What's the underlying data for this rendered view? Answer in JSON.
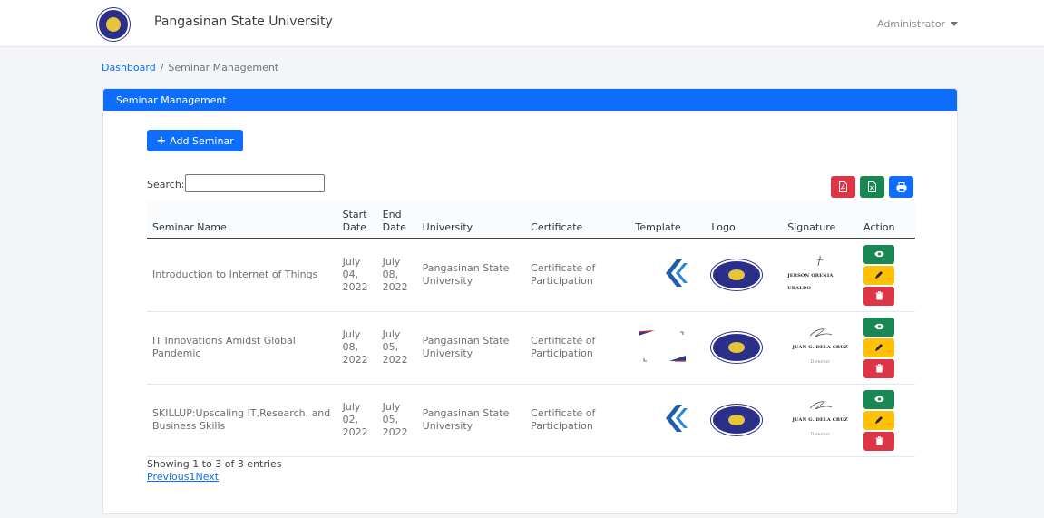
{
  "header": {
    "brand_name": "Pangasinan State University",
    "user_label": "Administrator"
  },
  "breadcrumb": {
    "home": "Dashboard",
    "separator": "/",
    "current": "Seminar Management"
  },
  "card": {
    "title": "Seminar Management",
    "add_button_label": "Add Seminar",
    "search_label": "Search:",
    "search_value": ""
  },
  "exports": [
    {
      "icon": "pdf-icon"
    },
    {
      "icon": "excel-icon"
    },
    {
      "icon": "print-icon"
    }
  ],
  "table": {
    "columns": [
      "Seminar Name",
      "Start Date",
      "End Date",
      "University",
      "Certificate",
      "Template",
      "Logo",
      "Signature",
      "Action"
    ],
    "rows": [
      {
        "name": "Introduction to Internet of Things",
        "start": "July 04, 2022",
        "end": "July 08, 2022",
        "university": "Pangasinan State University",
        "certificate": "Certificate of Participation",
        "template": "chevron",
        "signature_name": "JERSON ORENIA UBALDO",
        "signature_title": ""
      },
      {
        "name": "IT Innovations Amidst Global Pandemic",
        "start": "July 08, 2022",
        "end": "July 05, 2022",
        "university": "Pangasinan State University",
        "certificate": "Certificate of Participation",
        "template": "frame",
        "signature_name": "JUAN G. DELA CRUZ",
        "signature_title": "Director"
      },
      {
        "name": "SKILLUP:Upscaling IT,Research, and Business Skills",
        "start": "July 02, 2022",
        "end": "July 05, 2022",
        "university": "Pangasinan State University",
        "certificate": "Certificate of Participation",
        "template": "chevron",
        "signature_name": "JUAN G. DELA CRUZ",
        "signature_title": "Director"
      }
    ]
  },
  "footer": {
    "info": "Showing 1 to 3 of 3 entries",
    "pagination": "Previous1Next"
  },
  "colors": {
    "primary": "#0d6efd",
    "success": "#198754",
    "warning": "#ffc107",
    "danger": "#dc3545"
  }
}
